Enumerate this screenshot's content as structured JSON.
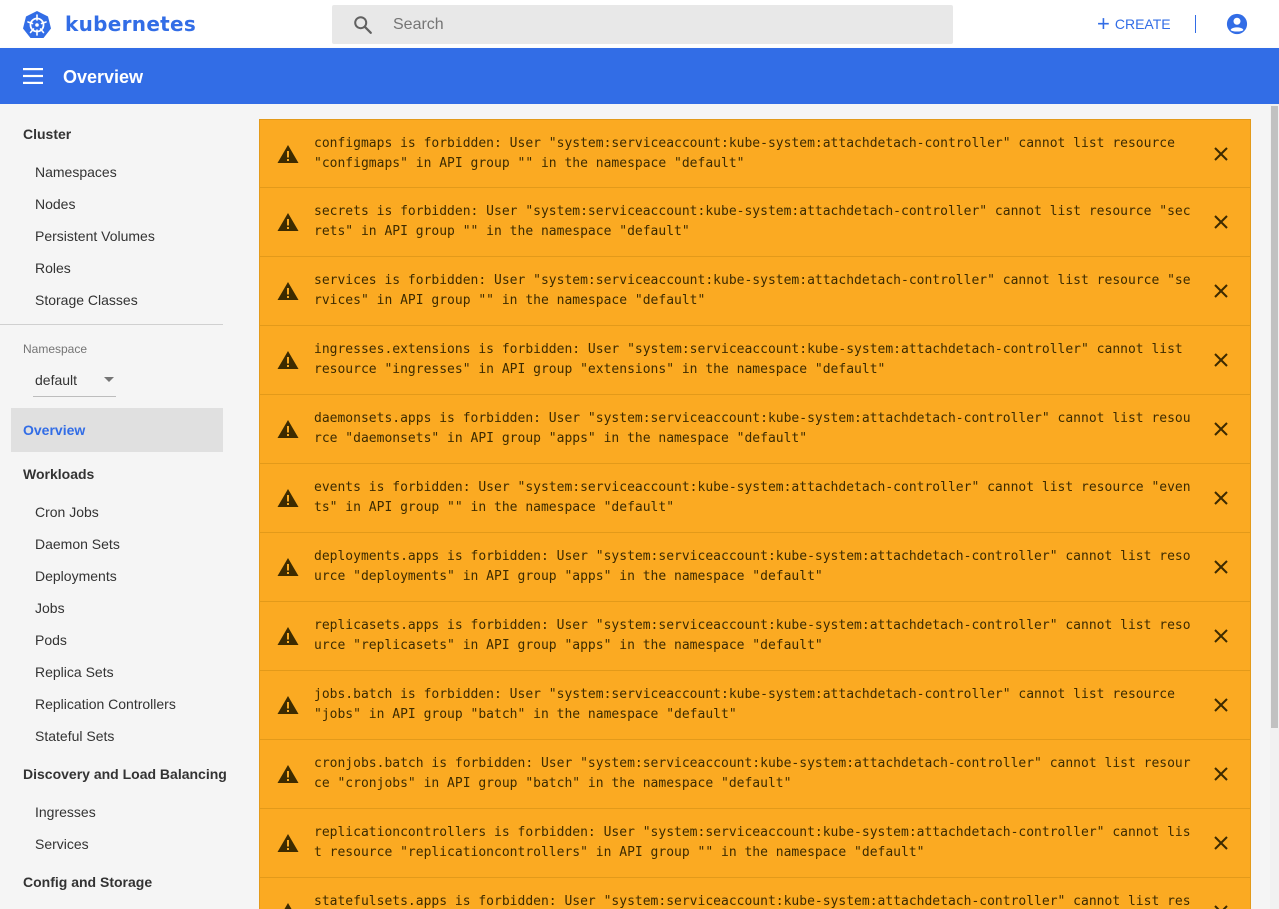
{
  "app": {
    "brand": "kubernetes"
  },
  "search": {
    "placeholder": "Search"
  },
  "toolbar": {
    "create_label": "CREATE",
    "create_icon": "plus-icon",
    "account_icon": "account-circle-icon"
  },
  "header": {
    "title": "Overview",
    "menu_icon": "hamburger-menu-icon"
  },
  "sidebar": {
    "cluster_label": "Cluster",
    "cluster_items": [
      "Namespaces",
      "Nodes",
      "Persistent Volumes",
      "Roles",
      "Storage Classes"
    ],
    "namespace_label": "Namespace",
    "namespace_value": "default",
    "active_item": "Overview",
    "workloads_label": "Workloads",
    "workloads_items": [
      "Cron Jobs",
      "Daemon Sets",
      "Deployments",
      "Jobs",
      "Pods",
      "Replica Sets",
      "Replication Controllers",
      "Stateful Sets"
    ],
    "discovery_label": "Discovery and Load Balancing",
    "discovery_items": [
      "Ingresses",
      "Services"
    ],
    "config_label": "Config and Storage"
  },
  "alerts": [
    "configmaps is forbidden: User \"system:serviceaccount:kube-system:attachdetach-controller\" cannot list resource \"configmaps\" in API group \"\" in the namespace \"default\"",
    "secrets is forbidden: User \"system:serviceaccount:kube-system:attachdetach-controller\" cannot list resource \"secrets\" in API group \"\" in the namespace \"default\"",
    "services is forbidden: User \"system:serviceaccount:kube-system:attachdetach-controller\" cannot list resource \"services\" in API group \"\" in the namespace \"default\"",
    "ingresses.extensions is forbidden: User \"system:serviceaccount:kube-system:attachdetach-controller\" cannot list resource \"ingresses\" in API group \"extensions\" in the namespace \"default\"",
    "daemonsets.apps is forbidden: User \"system:serviceaccount:kube-system:attachdetach-controller\" cannot list resource \"daemonsets\" in API group \"apps\" in the namespace \"default\"",
    "events is forbidden: User \"system:serviceaccount:kube-system:attachdetach-controller\" cannot list resource \"events\" in API group \"\" in the namespace \"default\"",
    "deployments.apps is forbidden: User \"system:serviceaccount:kube-system:attachdetach-controller\" cannot list resource \"deployments\" in API group \"apps\" in the namespace \"default\"",
    "replicasets.apps is forbidden: User \"system:serviceaccount:kube-system:attachdetach-controller\" cannot list resource \"replicasets\" in API group \"apps\" in the namespace \"default\"",
    "jobs.batch is forbidden: User \"system:serviceaccount:kube-system:attachdetach-controller\" cannot list resource \"jobs\" in API group \"batch\" in the namespace \"default\"",
    "cronjobs.batch is forbidden: User \"system:serviceaccount:kube-system:attachdetach-controller\" cannot list resource \"cronjobs\" in API group \"batch\" in the namespace \"default\"",
    "replicationcontrollers is forbidden: User \"system:serviceaccount:kube-system:attachdetach-controller\" cannot list resource \"replicationcontrollers\" in API group \"\" in the namespace \"default\"",
    "statefulsets.apps is forbidden: User \"system:serviceaccount:kube-system:attachdetach-controller\" cannot list resource \"statefulsets\" in API group \"apps\" in the namespace \"default\""
  ],
  "alert_icon": "warning-icon",
  "alert_close_icon": "close-icon",
  "colors": {
    "brand_blue": "#326de6",
    "alert_bg": "#fbaa22",
    "alert_text": "#3d2b00",
    "sidebar_bg": "#f5f5f5"
  }
}
